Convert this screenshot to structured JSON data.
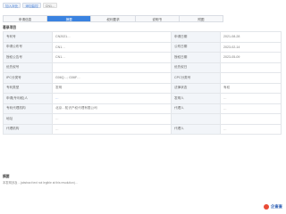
{
  "breadcrumbs": [
    "加入对比",
    "添加监控",
    "CN1..."
  ],
  "tabs": [
    {
      "label": "申请信息",
      "active": false
    },
    {
      "label": "摘要",
      "active": true
    },
    {
      "label": "权利要求",
      "active": false
    },
    {
      "label": "说明书",
      "active": false
    },
    {
      "label": "附图",
      "active": false
    }
  ],
  "section_title": "著录项目",
  "info_rows": [
    {
      "label_a": "专利号",
      "value_a": "CN2021…",
      "label_b": "申请日期",
      "value_b": "2021-08-28"
    },
    {
      "label_a": "申请公布号",
      "value_a": "CN1…",
      "label_b": "公布日期",
      "value_b": "2023-02-14"
    },
    {
      "label_a": "授权公告号",
      "value_a": "CN1…",
      "label_b": "授权日期",
      "value_b": "2023-05-09"
    },
    {
      "label_a": "优先权号",
      "value_a": "",
      "label_b": "优先权日",
      "value_b": ""
    },
    {
      "label_a": "IPC分类号",
      "value_a": "G06Q…; G06F…",
      "label_b": "CPC分类号",
      "value_b": ""
    },
    {
      "label_a": "专利类型",
      "value_a": "发明",
      "label_b": "法律状态",
      "value_b": "有权"
    },
    {
      "label_a": "申请(专利权)人",
      "value_a": "…",
      "label_b": "发明人",
      "value_b": "…",
      "link": true
    },
    {
      "label_a": "专利代理机构",
      "value_a": "北京…知识产权代理有限公司",
      "label_b": "代理人",
      "value_b": "…"
    },
    {
      "label_a": "地址",
      "value_a": "…",
      "label_b": "",
      "value_b": ""
    },
    {
      "label_a": "代理机构",
      "value_a": "…",
      "label_b": "代理人",
      "value_b": "…"
    }
  ],
  "abstract_title": "摘要",
  "abstract_text": "本发明涉及…(abstract text not legible at this resolution)…",
  "footer_left": "",
  "brand": {
    "text": "企查查",
    "color": "#2d5fb4",
    "mark_color": "#e94b35"
  }
}
